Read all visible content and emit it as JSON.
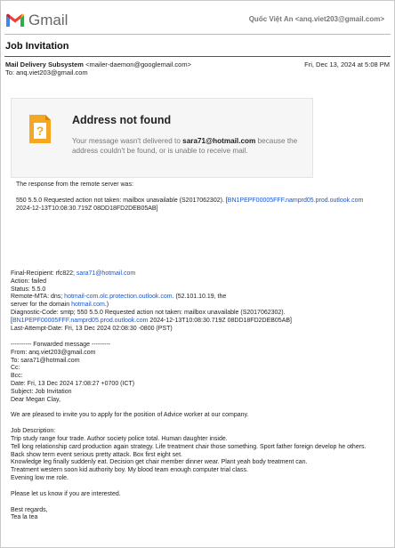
{
  "app": {
    "logo_text": "Gmail",
    "account": "Quốc Việt An <anq.viet203@gmail.com>"
  },
  "message": {
    "subject": "Job Invitation",
    "sender_name": "Mail Delivery Subsystem",
    "sender_email": "<mailer-daemon@googlemail.com>",
    "date": "Fri, Dec 13, 2024 at 5:08 PM",
    "to": "To: anq.viet203@gmail.com"
  },
  "bounce": {
    "title": "Address not found",
    "line1_prefix": "Your message wasn't delivered to ",
    "recipient": "sara71@hotmail.com",
    "line1_suffix": "",
    "line2": "because the address couldn't be found, or is unable to receive mail.",
    "server_intro": "The response from the remote server was:",
    "server_response_prefix": "550 5.5.0 Requested action not taken: mailbox unavailable (S2017062302). [",
    "server_response_link": "BN1PEPF00005FFF.namprd05.prod.outlook.com",
    "server_response_suffix": "]",
    "server_response_line2": "2024-12-13T10:08:30.719Z 08DD18FD2DEB05AB]"
  },
  "diagnostics": {
    "final_recipient_prefix": "Final-Recipient: rfc822; ",
    "final_recipient_link": "sara71@hotmail.com",
    "action": "Action: failed",
    "status": "Status: 5.5.0",
    "remote_mta_prefix": "Remote-MTA: dns; ",
    "remote_mta_link": "hotmail-com.olc.protection.outlook.com",
    "remote_mta_suffix": ". (52.101.10.19, the",
    "remote_mta_line2_prefix": " server for the domain ",
    "remote_mta_line2_link": "hotmail.com",
    "remote_mta_line2_suffix": ".)",
    "diag_code": "Diagnostic-Code: smtp; 550 5.5.0 Requested action not taken: mailbox unavailable (S2017062302).",
    "diag_link_prefix": "[",
    "diag_link": "BN1PEPF00005FFF.namprd05.prod.outlook.com",
    "diag_link_suffix": " 2024-12-13T10:08:30.719Z 08DD18FD2DEB05AB]",
    "last_attempt": "Last-Attempt-Date: Fri, 13 Dec 2024 02:08:30 -0800 (PST)"
  },
  "forwarded": {
    "separator": "---------- Forwarded message ---------",
    "from": "From: anq.viet203@gmail.com",
    "to": "To: sara71@hotmail.com",
    "cc": "Cc:",
    "bcc": "Bcc:",
    "date": "Date: Fri, 13 Dec 2024 17:08:27 +0700 (ICT)",
    "subject": "Subject: Job Invitation",
    "greeting": "Dear Megan Clay,",
    "intro": "We are pleased to invite you to apply for the position of Advice worker at our company.",
    "desc_heading": "Job Description:",
    "desc_lines": [
      "Trip study range four trade. Author society police total. Human daughter inside.",
      "Tell long relationship card production again strategy. Life treatment chair those something. Sport father foreign develop he others.",
      "Back show term event serious pretty attack. Box first eight set.",
      "Knowledge leg finally suddenly eat. Decision get chair member dinner wear. Plant yeah body treatment can.",
      "Treatment western soon kid authority boy. My blood team enough computer trial class.",
      "Evening low me role."
    ],
    "closing": "Please let us know if you are interested.",
    "regards": "Best regards,",
    "signature": "Tea la tea"
  }
}
